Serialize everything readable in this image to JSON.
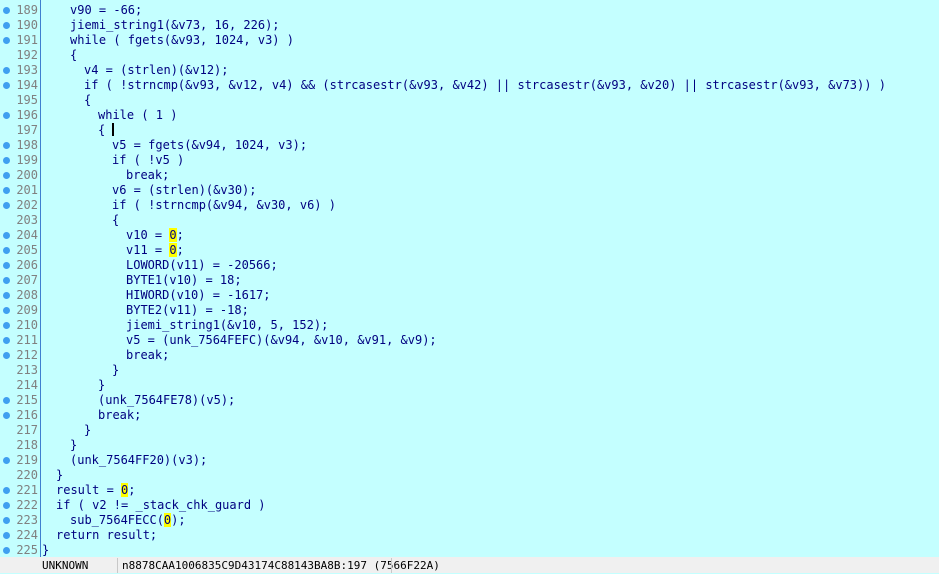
{
  "colors": {
    "background": "#c4ffff",
    "code": "#000080",
    "variable": "#8181e6",
    "highlight": "#ffff00",
    "line_number": "#808080",
    "breakpoint_dot": "#3f9ff0"
  },
  "lines": [
    {
      "n": "189",
      "dot": true,
      "indent": 2,
      "code": "v90 = -66;"
    },
    {
      "n": "190",
      "dot": true,
      "indent": 2,
      "code": "jiemi_string1(&v73, 16, 226);"
    },
    {
      "n": "191",
      "dot": true,
      "indent": 2,
      "code": "while ( fgets(&v93, 1024, v3) )"
    },
    {
      "n": "192",
      "dot": false,
      "indent": 2,
      "code": "{"
    },
    {
      "n": "193",
      "dot": true,
      "indent": 3,
      "code": "v4 = (strlen)(&v12);"
    },
    {
      "n": "194",
      "dot": true,
      "indent": 3,
      "code": "if ( !strncmp(&v93, &v12, v4) && (strcasestr(&v93, &v42) || strcasestr(&v93, &v20) || strcasestr(&v93, &v73)) )"
    },
    {
      "n": "195",
      "dot": false,
      "indent": 3,
      "code": "{"
    },
    {
      "n": "196",
      "dot": true,
      "indent": 4,
      "code": "while ( 1 )"
    },
    {
      "n": "197",
      "dot": false,
      "indent": 4,
      "code": "{ ",
      "cursor": true
    },
    {
      "n": "198",
      "dot": true,
      "indent": 5,
      "code": "v5 = fgets(&v94, 1024, v3);"
    },
    {
      "n": "199",
      "dot": true,
      "indent": 5,
      "code": "if ( !v5 )"
    },
    {
      "n": "200",
      "dot": true,
      "indent": 6,
      "code": "break;"
    },
    {
      "n": "201",
      "dot": true,
      "indent": 5,
      "code": "v6 = (strlen)(&v30);"
    },
    {
      "n": "202",
      "dot": true,
      "indent": 5,
      "code": "if ( !strncmp(&v94, &v30, v6) )"
    },
    {
      "n": "203",
      "dot": false,
      "indent": 5,
      "code": "{"
    },
    {
      "n": "204",
      "dot": true,
      "indent": 6,
      "code": "v10 = 0;",
      "hl": true
    },
    {
      "n": "205",
      "dot": true,
      "indent": 6,
      "code": "v11 = 0;",
      "hl": true
    },
    {
      "n": "206",
      "dot": true,
      "indent": 6,
      "code": "LOWORD(v11) = -20566;"
    },
    {
      "n": "207",
      "dot": true,
      "indent": 6,
      "code": "BYTE1(v10) = 18;"
    },
    {
      "n": "208",
      "dot": true,
      "indent": 6,
      "code": "HIWORD(v10) = -1617;"
    },
    {
      "n": "209",
      "dot": true,
      "indent": 6,
      "code": "BYTE2(v11) = -18;"
    },
    {
      "n": "210",
      "dot": true,
      "indent": 6,
      "code": "jiemi_string1(&v10, 5, 152);"
    },
    {
      "n": "211",
      "dot": true,
      "indent": 6,
      "code": "v5 = (unk_7564FEFC)(&v94, &v10, &v91, &v9);"
    },
    {
      "n": "212",
      "dot": true,
      "indent": 6,
      "code": "break;"
    },
    {
      "n": "213",
      "dot": false,
      "indent": 5,
      "code": "}"
    },
    {
      "n": "214",
      "dot": false,
      "indent": 4,
      "code": "}"
    },
    {
      "n": "215",
      "dot": true,
      "indent": 4,
      "code": "(unk_7564FE78)(v5);"
    },
    {
      "n": "216",
      "dot": true,
      "indent": 4,
      "code": "break;"
    },
    {
      "n": "217",
      "dot": false,
      "indent": 3,
      "code": "}"
    },
    {
      "n": "218",
      "dot": false,
      "indent": 2,
      "code": "}"
    },
    {
      "n": "219",
      "dot": true,
      "indent": 2,
      "code": "(unk_7564FF20)(v3);"
    },
    {
      "n": "220",
      "dot": false,
      "indent": 1,
      "code": "}"
    },
    {
      "n": "221",
      "dot": true,
      "indent": 1,
      "code": "result = 0;",
      "hl": true
    },
    {
      "n": "222",
      "dot": true,
      "indent": 1,
      "code": "if ( v2 != _stack_chk_guard )"
    },
    {
      "n": "223",
      "dot": true,
      "indent": 2,
      "code": "sub_7564FECC(0);",
      "hl": true
    },
    {
      "n": "224",
      "dot": true,
      "indent": 1,
      "code": "return result;"
    },
    {
      "n": "225",
      "dot": true,
      "indent": 0,
      "code": "}"
    }
  ],
  "status": {
    "state": "UNKNOWN",
    "location": "n8878CAA1006835C9D43174C88143BA8B:197 (7566F22A)"
  }
}
